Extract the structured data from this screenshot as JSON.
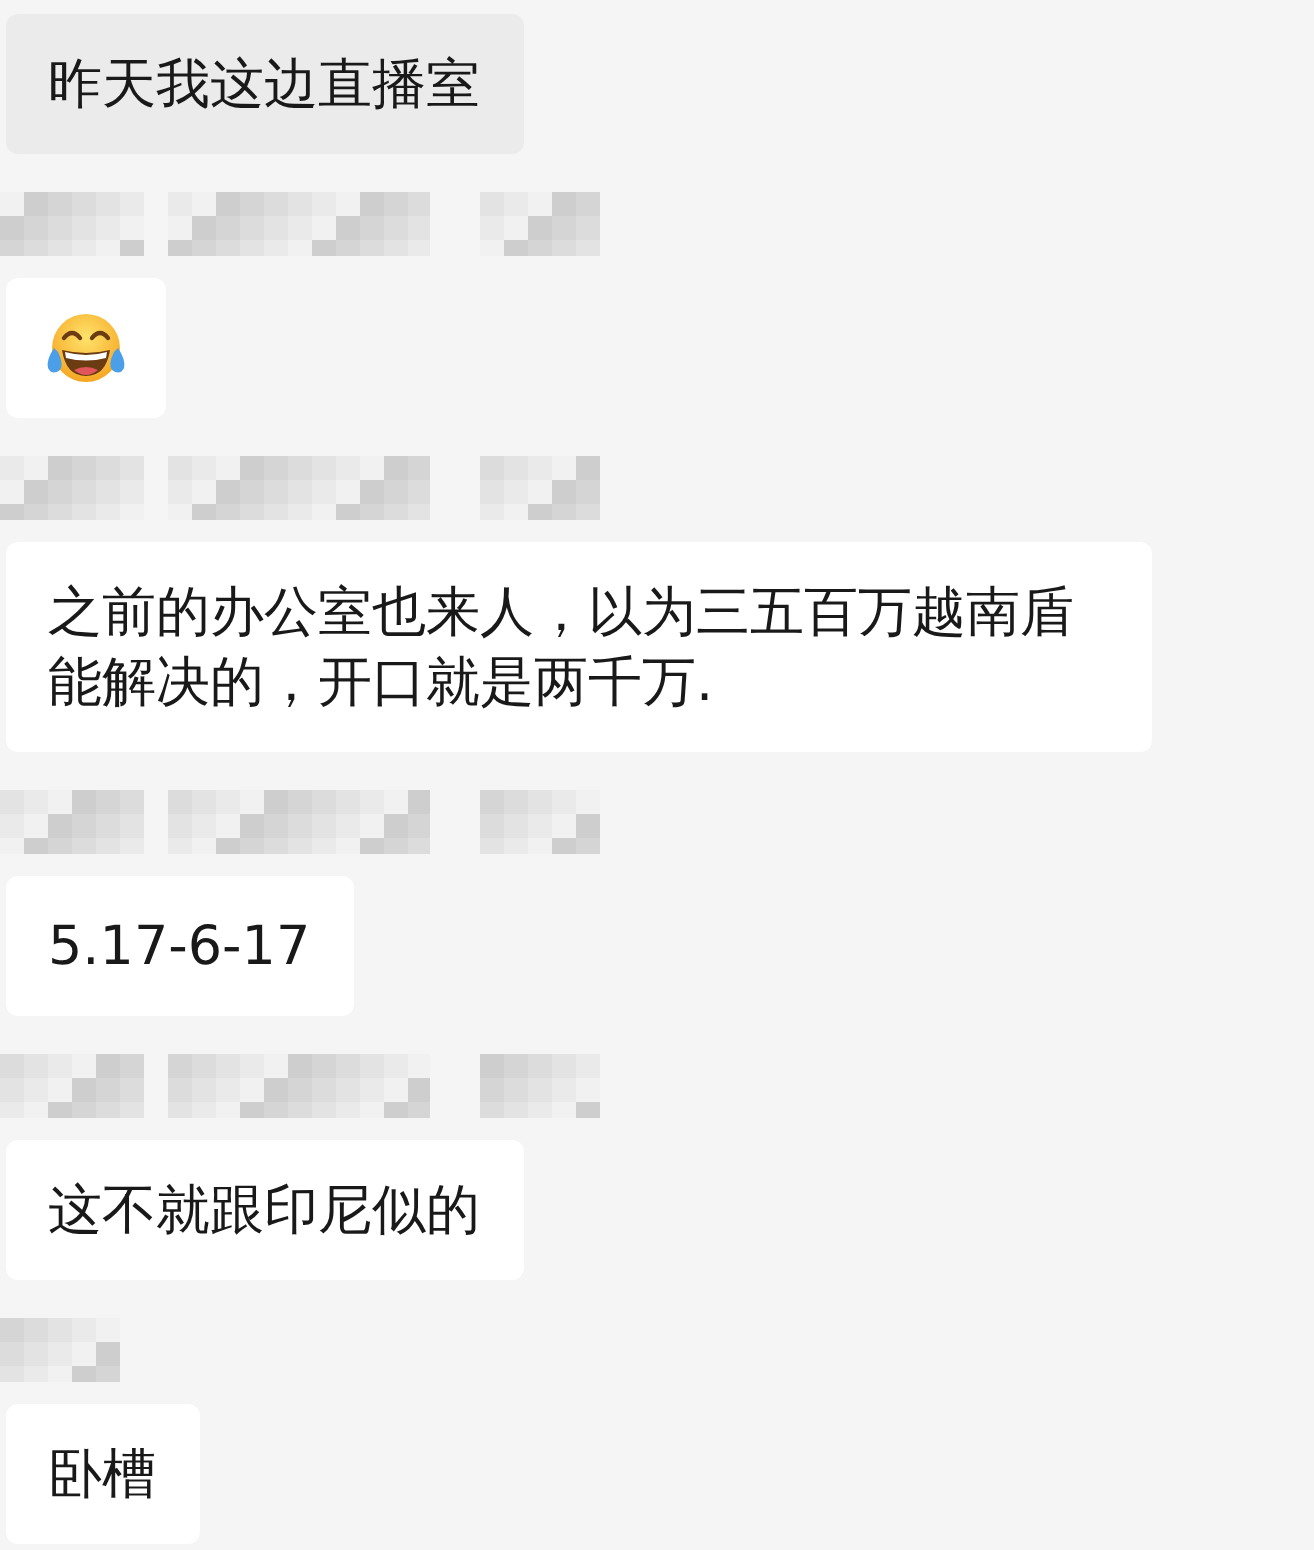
{
  "messages": [
    {
      "kind": "text",
      "highlighted": true,
      "text": "昨天我这边直播室"
    },
    {
      "kind": "emoji",
      "sender": {
        "redacted": true,
        "short": false
      },
      "highlighted": false
    },
    {
      "kind": "text",
      "sender": {
        "redacted": true,
        "short": false
      },
      "highlighted": false,
      "text": "之前的办公室也来人，以为三五百万越南盾能解决的，开口就是两千万."
    },
    {
      "kind": "text",
      "sender": {
        "redacted": true,
        "short": false
      },
      "highlighted": false,
      "text": "5.17-6-17"
    },
    {
      "kind": "text",
      "sender": {
        "redacted": true,
        "short": false
      },
      "highlighted": false,
      "text": "这不就跟印尼似的"
    },
    {
      "kind": "text",
      "sender": {
        "redacted": true,
        "short": true
      },
      "highlighted": false,
      "text": "卧槽"
    }
  ]
}
